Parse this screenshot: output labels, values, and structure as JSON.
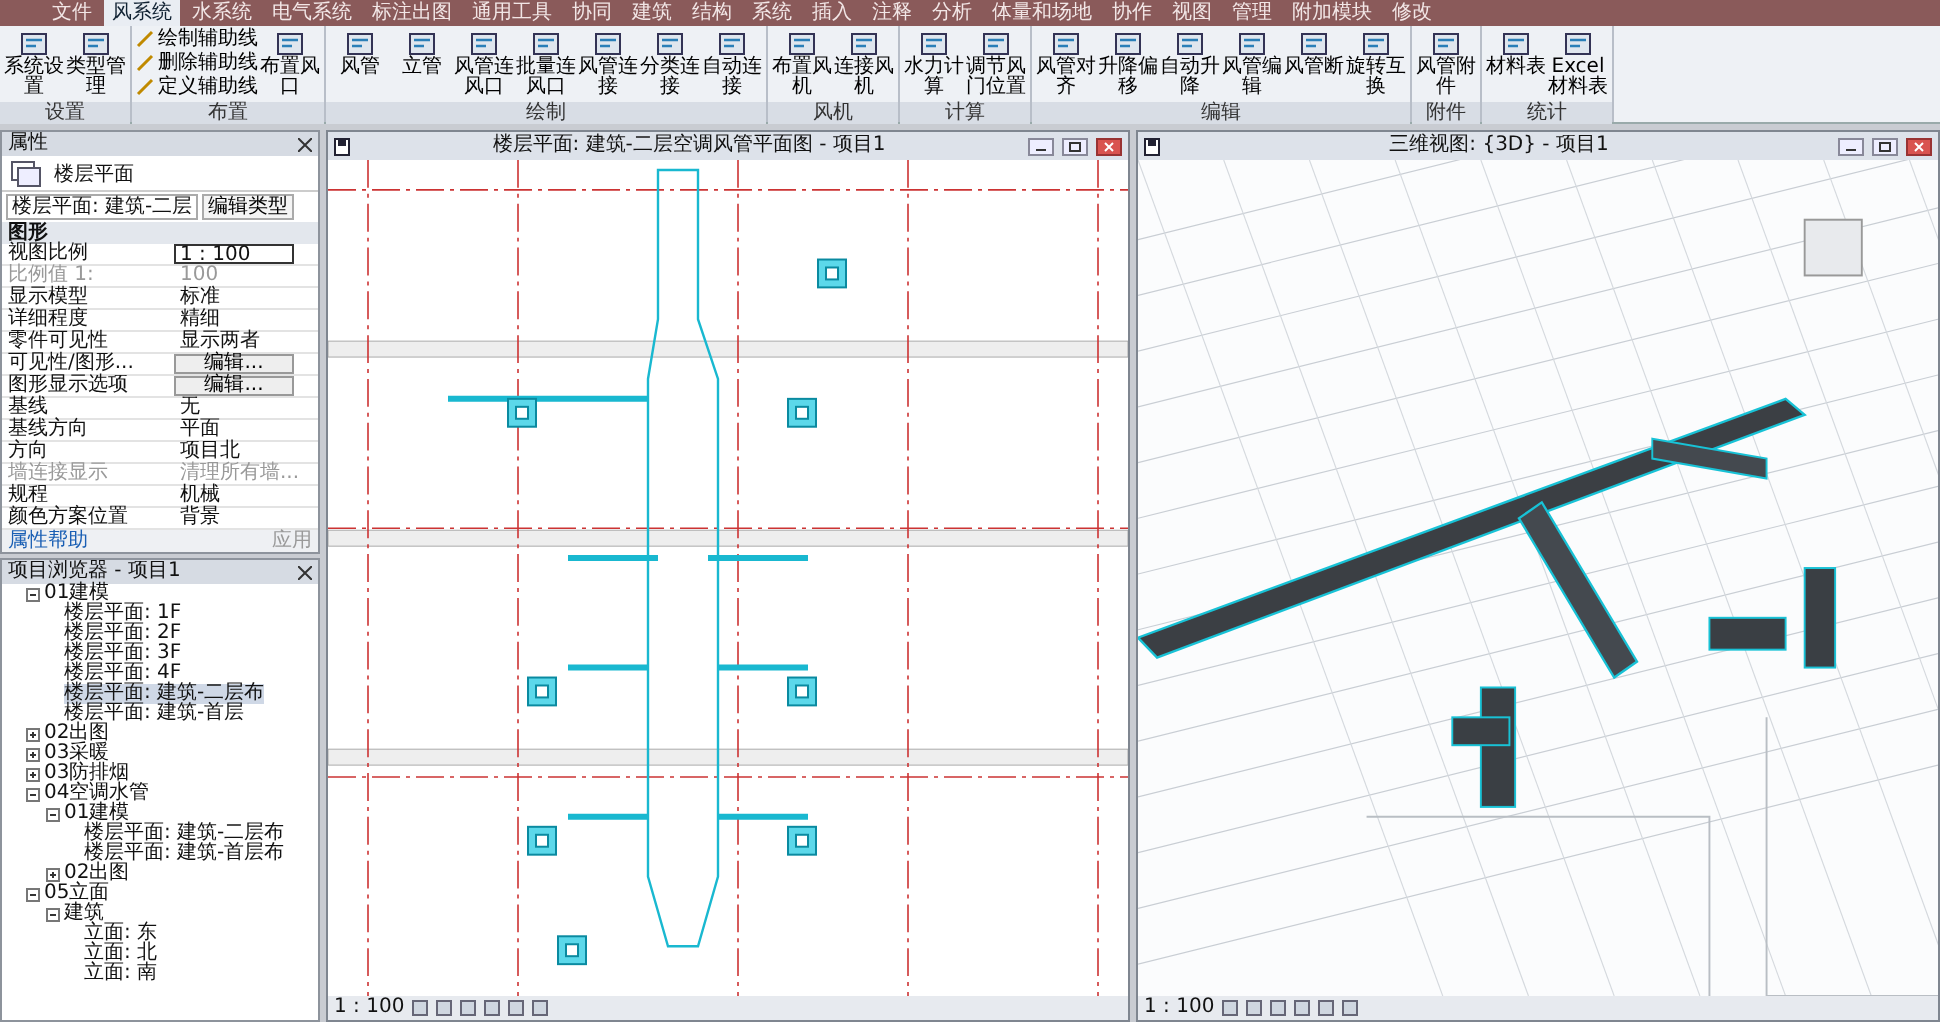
{
  "menu_tabs": [
    {
      "label": "文件",
      "selected": false
    },
    {
      "label": "风系统",
      "selected": true
    },
    {
      "label": "水系统",
      "selected": false
    },
    {
      "label": "电气系统",
      "selected": false
    },
    {
      "label": "标注出图",
      "selected": false
    },
    {
      "label": "通用工具",
      "selected": false
    },
    {
      "label": "协同",
      "selected": false
    },
    {
      "label": "建筑",
      "selected": false
    },
    {
      "label": "结构",
      "selected": false
    },
    {
      "label": "系统",
      "selected": false
    },
    {
      "label": "插入",
      "selected": false
    },
    {
      "label": "注释",
      "selected": false
    },
    {
      "label": "分析",
      "selected": false
    },
    {
      "label": "体量和场地",
      "selected": false
    },
    {
      "label": "协作",
      "selected": false
    },
    {
      "label": "视图",
      "selected": false
    },
    {
      "label": "管理",
      "selected": false
    },
    {
      "label": "附加模块",
      "selected": false
    },
    {
      "label": "修改",
      "selected": false
    }
  ],
  "ribbon": [
    {
      "label": "设置",
      "buttons": [
        {
          "label": "系统设置",
          "kind": "large"
        },
        {
          "label": "类型管理",
          "kind": "large"
        }
      ]
    },
    {
      "label": "布置",
      "buttons": [
        {
          "label": "绘制辅助线",
          "kind": "small"
        },
        {
          "label": "删除辅助线",
          "kind": "small"
        },
        {
          "label": "定义辅助线",
          "kind": "small"
        },
        {
          "label": "布置风口",
          "kind": "large"
        }
      ]
    },
    {
      "label": "绘制",
      "buttons": [
        {
          "label": "风管",
          "kind": "large"
        },
        {
          "label": "立管",
          "kind": "large"
        },
        {
          "label": "风管连风口",
          "kind": "large"
        },
        {
          "label": "批量连风口",
          "kind": "large"
        },
        {
          "label": "风管连接",
          "kind": "large"
        },
        {
          "label": "分类连接",
          "kind": "large"
        },
        {
          "label": "自动连接",
          "kind": "large"
        }
      ]
    },
    {
      "label": "风机",
      "buttons": [
        {
          "label": "布置风机",
          "kind": "large"
        },
        {
          "label": "连接风机",
          "kind": "large"
        }
      ]
    },
    {
      "label": "计算",
      "buttons": [
        {
          "label": "水力计算",
          "kind": "large"
        },
        {
          "label": "调节风门位置",
          "kind": "large"
        }
      ]
    },
    {
      "label": "编辑",
      "buttons": [
        {
          "label": "风管对齐",
          "kind": "large"
        },
        {
          "label": "升降偏移",
          "kind": "large"
        },
        {
          "label": "自动升降",
          "kind": "large"
        },
        {
          "label": "风管编辑",
          "kind": "large"
        },
        {
          "label": "风管断",
          "kind": "large"
        },
        {
          "label": "旋转互换",
          "kind": "large"
        }
      ]
    },
    {
      "label": "附件",
      "buttons": [
        {
          "label": "风管附件",
          "kind": "large"
        }
      ]
    },
    {
      "label": "统计",
      "buttons": [
        {
          "label": "材料表",
          "kind": "large"
        },
        {
          "label": "Excel材料表",
          "kind": "large"
        }
      ]
    }
  ],
  "properties": {
    "title": "属性",
    "type_name": "楼层平面",
    "type_selector": "楼层平面: 建筑-二层",
    "edit_type": "编辑类型",
    "section": "图形",
    "rows": [
      {
        "label": "视图比例",
        "value": "1 : 100",
        "kind": "input",
        "disabled": false
      },
      {
        "label": "比例值 1:",
        "value": "100",
        "kind": "text",
        "disabled": true
      },
      {
        "label": "显示模型",
        "value": "标准",
        "kind": "text",
        "disabled": false
      },
      {
        "label": "详细程度",
        "value": "精细",
        "kind": "text",
        "disabled": false
      },
      {
        "label": "零件可见性",
        "value": "显示两者",
        "kind": "text",
        "disabled": false
      },
      {
        "label": "可见性/图形...",
        "value": "编辑...",
        "kind": "button",
        "disabled": false
      },
      {
        "label": "图形显示选项",
        "value": "编辑...",
        "kind": "button",
        "disabled": false
      },
      {
        "label": "基线",
        "value": "无",
        "kind": "text",
        "disabled": false
      },
      {
        "label": "基线方向",
        "value": "平面",
        "kind": "text",
        "disabled": false
      },
      {
        "label": "方向",
        "value": "项目北",
        "kind": "text",
        "disabled": false
      },
      {
        "label": "墙连接显示",
        "value": "清理所有墙...",
        "kind": "text",
        "disabled": true
      },
      {
        "label": "规程",
        "value": "机械",
        "kind": "text",
        "disabled": false
      },
      {
        "label": "颜色方案位置",
        "value": "背景",
        "kind": "text",
        "disabled": false
      }
    ],
    "help_link": "属性帮助",
    "apply": "应用"
  },
  "browser": {
    "title": "项目浏览器 - 项目1",
    "tree": [
      {
        "label": "01建模",
        "expanded": true,
        "selected": false,
        "children": [
          {
            "label": "楼层平面: 1F",
            "selected": false
          },
          {
            "label": "楼层平面: 2F",
            "selected": false
          },
          {
            "label": "楼层平面: 3F",
            "selected": false
          },
          {
            "label": "楼层平面: 4F",
            "selected": false
          },
          {
            "label": "楼层平面: 建筑-二层布",
            "selected": true
          },
          {
            "label": "楼层平面: 建筑-首层",
            "selected": false
          }
        ]
      },
      {
        "label": "02出图",
        "expanded": false,
        "selected": false
      },
      {
        "label": "03采暖",
        "expanded": false,
        "selected": false
      },
      {
        "label": "03防排烟",
        "expanded": false,
        "selected": false
      },
      {
        "label": "04空调水管",
        "expanded": true,
        "selected": false,
        "children": [
          {
            "label": "01建模",
            "expanded": true,
            "selected": false,
            "children": [
              {
                "label": "楼层平面: 建筑-二层布",
                "selected": false
              },
              {
                "label": "楼层平面: 建筑-首层布",
                "selected": false
              }
            ]
          },
          {
            "label": "02出图",
            "expanded": false,
            "selected": false
          }
        ]
      },
      {
        "label": "05立面",
        "expanded": true,
        "selected": false,
        "children": [
          {
            "label": "建筑",
            "expanded": true,
            "selected": false,
            "children": [
              {
                "label": "立面: 东",
                "selected": false
              },
              {
                "label": "立面: 北",
                "selected": false
              },
              {
                "label": "立面: 南",
                "selected": false
              }
            ]
          }
        ]
      }
    ]
  },
  "views": [
    {
      "title": "楼层平面: 建筑-二层空调风管平面图 - 项目1",
      "kind": "plan",
      "scale": "1 : 100"
    },
    {
      "title": "三维视图: {3D} - 项目1",
      "kind": "model",
      "scale": "1 : 100"
    }
  ]
}
